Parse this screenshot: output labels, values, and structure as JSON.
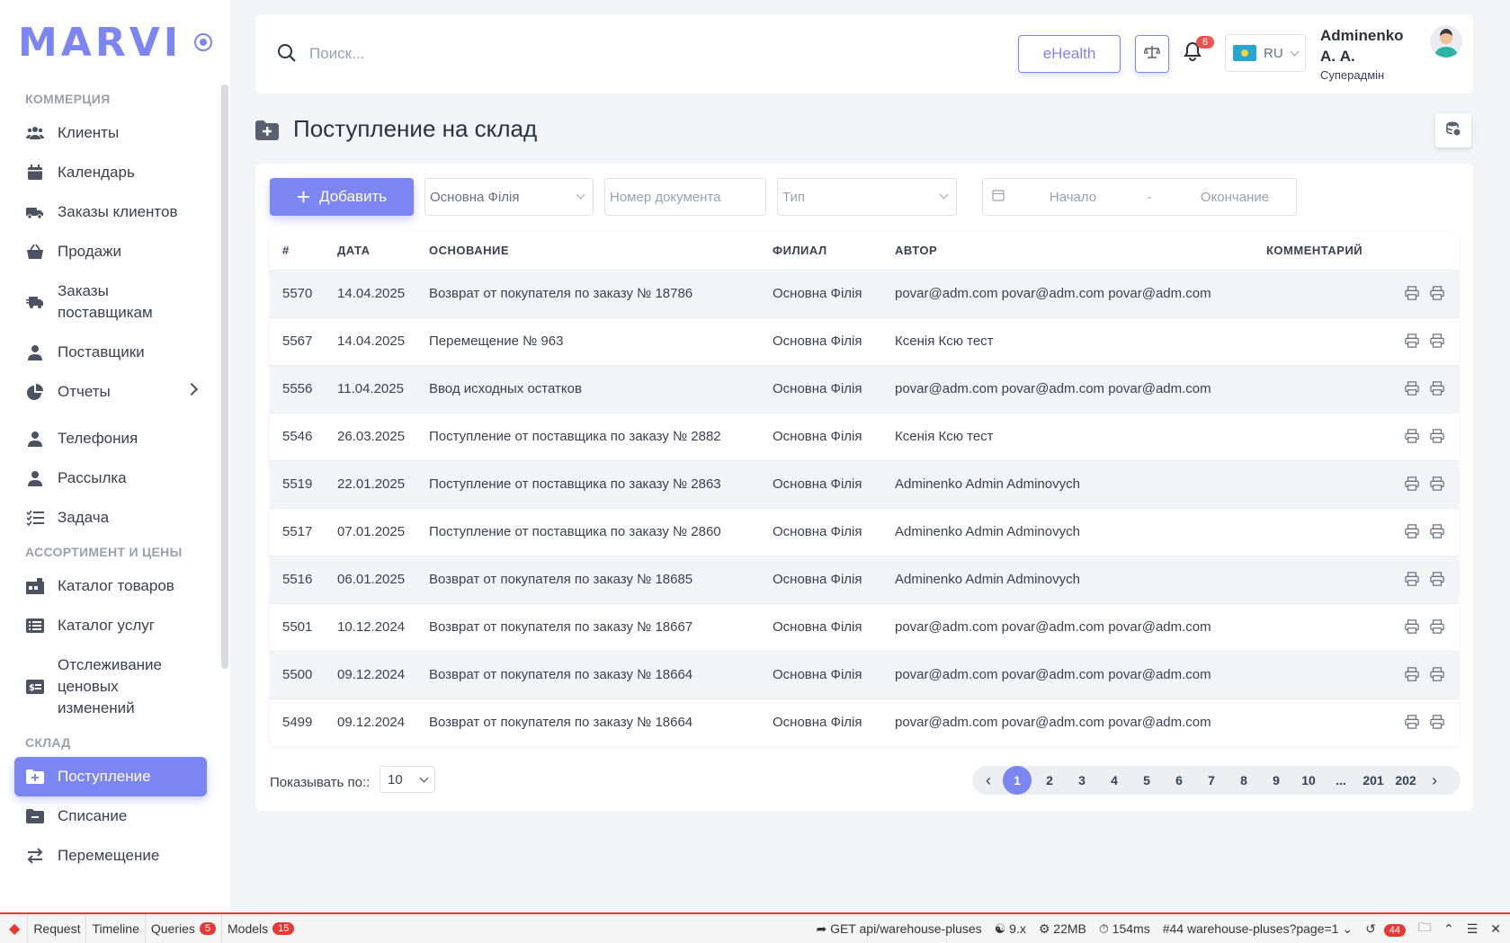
{
  "brand": {
    "logo": "MARVI"
  },
  "sidebar": {
    "sections": [
      {
        "title": "КОММЕРЦИЯ"
      },
      {
        "title": "АССОРТИМЕНТ И ЦЕНЫ"
      },
      {
        "title": "СКЛАД"
      }
    ],
    "items": {
      "clients": "Клиенты",
      "calendar": "Календарь",
      "client_orders": "Заказы клиентов",
      "sales": "Продажи",
      "supplier_orders": "Заказы поставщикам",
      "suppliers": "Поставщики",
      "reports": "Отчеты",
      "telephony": "Телефония",
      "mailing": "Рассылка",
      "task": "Задача",
      "goods_catalog": "Каталог товаров",
      "services_catalog": "Каталог услуг",
      "price_tracking": "Отслеживание ценовых изменений",
      "receipts": "Поступление",
      "writeoff": "Списание",
      "transfer": "Перемещение"
    }
  },
  "header": {
    "search_placeholder": "Поиск...",
    "ehealth": "eHealth",
    "notifications_count": "6",
    "language": "RU",
    "user_name": "Adminenko А. А.",
    "user_role": "Суперадмін"
  },
  "page": {
    "title": "Поступление на склад",
    "add_label": "Добавить",
    "branch_filter": "Основна Філія",
    "doc_number_placeholder": "Номер документа",
    "type_placeholder": "Тип",
    "date_start": "Начало",
    "date_sep": "-",
    "date_end": "Окончание"
  },
  "table": {
    "columns": [
      "#",
      "ДАТА",
      "ОСНОВАНИЕ",
      "ФИЛИАЛ",
      "АВТОР",
      "КОММЕНТАРИЙ"
    ],
    "rows": [
      {
        "id": "5570",
        "date": "14.04.2025",
        "basis": "Возврат от покупателя по заказу № 18786",
        "branch": "Основна Філія",
        "author": "povar@adm.com povar@adm.com povar@adm.com",
        "comment": ""
      },
      {
        "id": "5567",
        "date": "14.04.2025",
        "basis": "Перемещение № 963",
        "branch": "Основна Філія",
        "author": "Ксенія Ксю тест",
        "comment": ""
      },
      {
        "id": "5556",
        "date": "11.04.2025",
        "basis": "Ввод исходных остатков",
        "branch": "Основна Філія",
        "author": "povar@adm.com povar@adm.com povar@adm.com",
        "comment": ""
      },
      {
        "id": "5546",
        "date": "26.03.2025",
        "basis": "Поступление от поставщика по заказу № 2882",
        "branch": "Основна Філія",
        "author": "Ксенія Ксю тест",
        "comment": ""
      },
      {
        "id": "5519",
        "date": "22.01.2025",
        "basis": "Поступление от поставщика по заказу № 2863",
        "branch": "Основна Філія",
        "author": "Adminenko Admin Adminovych",
        "comment": ""
      },
      {
        "id": "5517",
        "date": "07.01.2025",
        "basis": "Поступление от поставщика по заказу № 2860",
        "branch": "Основна Філія",
        "author": "Adminenko Admin Adminovych",
        "comment": ""
      },
      {
        "id": "5516",
        "date": "06.01.2025",
        "basis": "Возврат от покупателя по заказу № 18685",
        "branch": "Основна Філія",
        "author": "Adminenko Admin Adminovych",
        "comment": ""
      },
      {
        "id": "5501",
        "date": "10.12.2024",
        "basis": "Возврат от покупателя по заказу № 18667",
        "branch": "Основна Філія",
        "author": "povar@adm.com povar@adm.com povar@adm.com",
        "comment": ""
      },
      {
        "id": "5500",
        "date": "09.12.2024",
        "basis": "Возврат от покупателя по заказу № 18664",
        "branch": "Основна Філія",
        "author": "povar@adm.com povar@adm.com povar@adm.com",
        "comment": ""
      },
      {
        "id": "5499",
        "date": "09.12.2024",
        "basis": "Возврат от покупателя по заказу № 18664",
        "branch": "Основна Філія",
        "author": "povar@adm.com povar@adm.com povar@adm.com",
        "comment": ""
      }
    ]
  },
  "pagination": {
    "per_page_label": "Показывать по::",
    "per_page": "10",
    "pages": [
      "1",
      "2",
      "3",
      "4",
      "5",
      "6",
      "7",
      "8",
      "9",
      "10",
      "...",
      "201",
      "202"
    ],
    "current": "1"
  },
  "debugbar": {
    "tabs": [
      {
        "label": "Request",
        "badge": ""
      },
      {
        "label": "Timeline",
        "badge": ""
      },
      {
        "label": "Queries",
        "badge": "5"
      },
      {
        "label": "Models",
        "badge": "15"
      }
    ],
    "route": "GET api/warehouse-pluses",
    "version": "9.x",
    "memory": "22MB",
    "time": "154ms",
    "request": "#44 warehouse-pluses?page=1",
    "history_count": "44"
  },
  "colors": {
    "accent": "#7c86f2",
    "badge": "#ef5350",
    "debug_red": "#e53935"
  }
}
